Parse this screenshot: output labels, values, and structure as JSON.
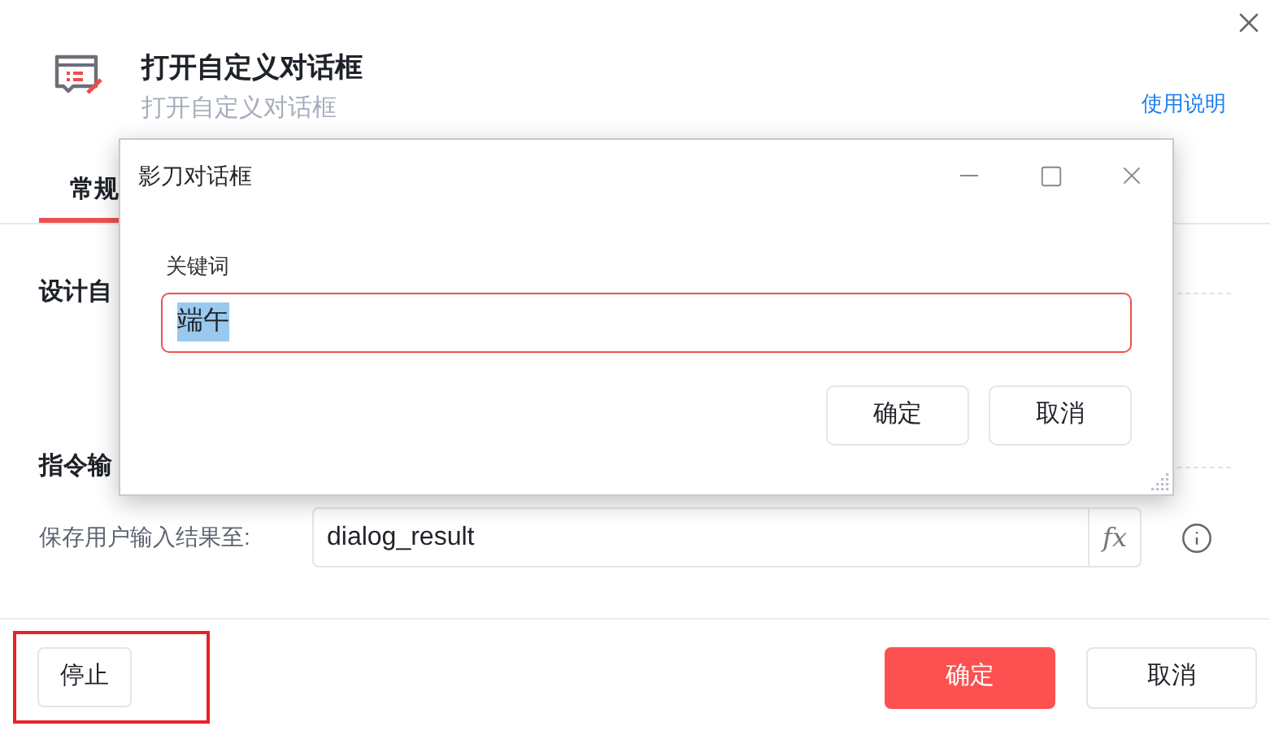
{
  "header": {
    "title": "打开自定义对话框",
    "subtitle": "打开自定义对话框",
    "help_link": "使用说明"
  },
  "tabs": [
    {
      "label": "常规",
      "selected": true
    }
  ],
  "sections": [
    {
      "title": "设计自"
    },
    {
      "title": "指令输"
    }
  ],
  "output_field": {
    "label": "保存用户输入结果至:",
    "value": "dialog_result",
    "fx": "fx"
  },
  "footer": {
    "stop_button": {
      "label": "停止",
      "highlighted": true
    },
    "buttons": [
      {
        "label": "确定",
        "kind": "primary"
      },
      {
        "label": "取消",
        "kind": "secondary"
      }
    ]
  },
  "dialog": {
    "title": "影刀对话框",
    "field_label": "关键词",
    "field_value": "端午",
    "value_selected": true,
    "focused": true,
    "buttons": [
      {
        "label": "确定"
      },
      {
        "label": "取消"
      }
    ]
  }
}
